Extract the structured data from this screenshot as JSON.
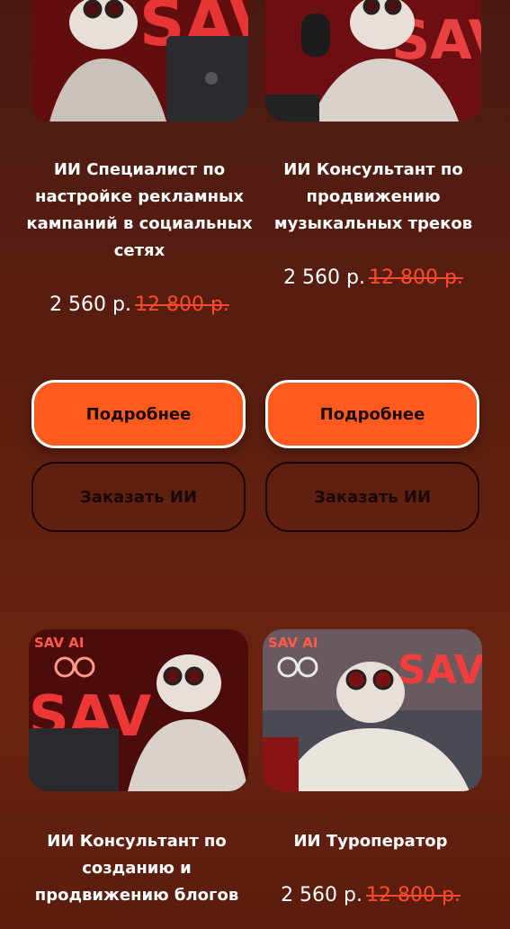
{
  "cards": [
    {
      "title_lines": [
        "ИИ Специалист по",
        "настройке рекламных",
        "кампаний в социальных",
        "сетях"
      ],
      "price": "2 560 р.",
      "old_price": "12 800 р.",
      "more_label": "Подробнее",
      "order_label": "Заказать ИИ",
      "image_text": "SAV"
    },
    {
      "title_lines": [
        "ИИ Консультант по",
        "продвижению",
        "музыкальных треков"
      ],
      "price": "2 560 р.",
      "old_price": "12 800 р.",
      "more_label": "Подробнее",
      "order_label": "Заказать ИИ",
      "image_text": "SAV"
    },
    {
      "title_lines": [
        "ИИ Консультант по",
        "созданию и",
        "продвижению блогов"
      ],
      "image_text": "SAV",
      "image_caption": "SAV AI"
    },
    {
      "title_lines": [
        "ИИ Туроператор"
      ],
      "price": "2 560 р.",
      "old_price": "12 800 р.",
      "image_text": "SAV",
      "image_caption": "SAV AI"
    }
  ],
  "colors": {
    "accent": "#ff5a1e",
    "old_price": "#ff4a2a",
    "background": "#5a1e10"
  }
}
